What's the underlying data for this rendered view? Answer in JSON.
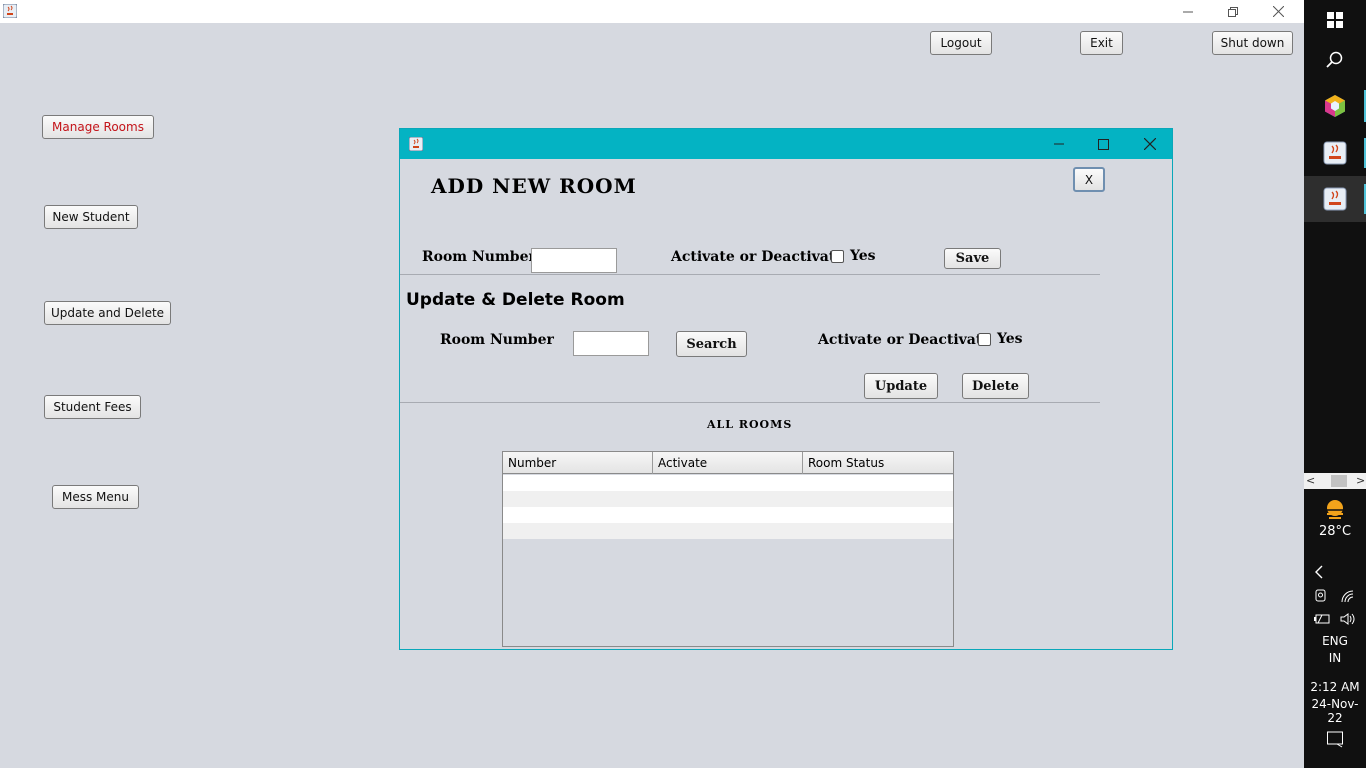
{
  "main_window": {
    "buttons": {
      "logout": "Logout",
      "exit": "Exit",
      "shutdown": "Shut down"
    },
    "sidebar": {
      "items": [
        {
          "label": "Manage Rooms"
        },
        {
          "label": "New Student"
        },
        {
          "label": "Update and Delete"
        },
        {
          "label": "Student Fees"
        },
        {
          "label": "Mess Menu"
        }
      ]
    }
  },
  "dialog": {
    "close_label": "X",
    "add_section": {
      "title": "ADD NEW ROOM",
      "room_number_label": "Room Number",
      "room_number_value": "",
      "activate_label": "Activate or Deactivate",
      "yes_label": "Yes",
      "yes_checked": false,
      "save_label": "Save"
    },
    "update_section": {
      "title": "Update & Delete Room",
      "room_number_label": "Room Number",
      "room_number_value": "",
      "search_label": "Search",
      "activate_label": "Activate or Deactivate",
      "yes_label": "Yes",
      "yes_checked": false,
      "update_label": "Update",
      "delete_label": "Delete"
    },
    "table": {
      "title": "ALL ROOMS",
      "columns": [
        "Number",
        "Activate",
        "Room Status"
      ],
      "rows": []
    }
  },
  "taskbar": {
    "weather_temp": "28°C",
    "language_line1": "ENG",
    "language_line2": "IN",
    "time": "2:12 AM",
    "date": "24-Nov-22"
  },
  "colors": {
    "dialog_title": "#04b3c3",
    "accent_red": "#c4141a",
    "background": "#d6d9e0"
  }
}
